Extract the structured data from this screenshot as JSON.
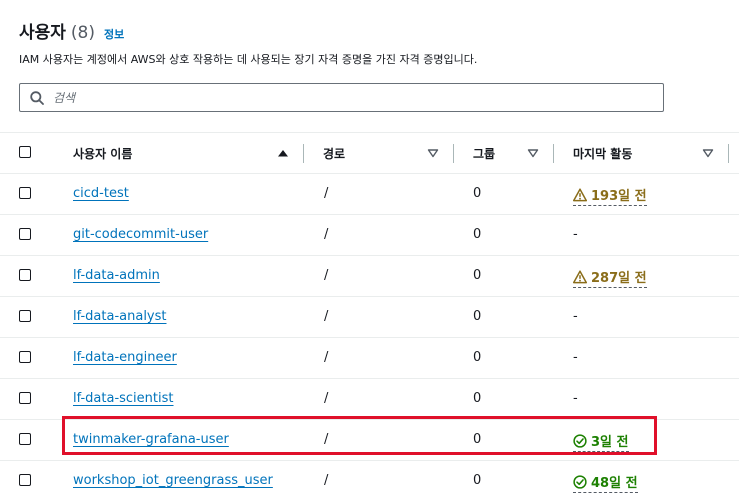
{
  "header": {
    "title": "사용자",
    "count": "(8)",
    "info_link": "정보",
    "description": "IAM 사용자는 계정에서 AWS와 상호 작용하는 데 사용되는 장기 자격 증명을 가진 자격 증명입니다."
  },
  "search": {
    "placeholder": "검색",
    "value": ""
  },
  "table": {
    "columns": {
      "name": "사용자 이름",
      "path": "경로",
      "groups": "그룹",
      "last_activity": "마지막 활동"
    },
    "sort": {
      "column": "사용자 이름",
      "direction": "ascending"
    },
    "rows": [
      {
        "name": "cicd-test",
        "path": "/",
        "groups": "0",
        "last_activity": "193일 전",
        "status": "warning"
      },
      {
        "name": "git-codecommit-user",
        "path": "/",
        "groups": "0",
        "last_activity": "-",
        "status": "none"
      },
      {
        "name": "lf-data-admin",
        "path": "/",
        "groups": "0",
        "last_activity": "287일 전",
        "status": "warning"
      },
      {
        "name": "lf-data-analyst",
        "path": "/",
        "groups": "0",
        "last_activity": "-",
        "status": "none"
      },
      {
        "name": "lf-data-engineer",
        "path": "/",
        "groups": "0",
        "last_activity": "-",
        "status": "none"
      },
      {
        "name": "lf-data-scientist",
        "path": "/",
        "groups": "0",
        "last_activity": "-",
        "status": "none"
      },
      {
        "name": "twinmaker-grafana-user",
        "path": "/",
        "groups": "0",
        "last_activity": "3일 전",
        "status": "ok"
      },
      {
        "name": "workshop_iot_greengrass_user",
        "path": "/",
        "groups": "0",
        "last_activity": "48일 전",
        "status": "ok"
      }
    ]
  },
  "colors": {
    "link": "#0073bb",
    "warning": "#8a6d1a",
    "ok": "#1d8102",
    "highlight": "#e0102a"
  },
  "icons": {
    "search": "search-icon",
    "warning": "warning-icon",
    "ok": "check-circle-icon",
    "sort_asc": "caret-up-icon",
    "sort_none": "caret-down-outline-icon"
  }
}
